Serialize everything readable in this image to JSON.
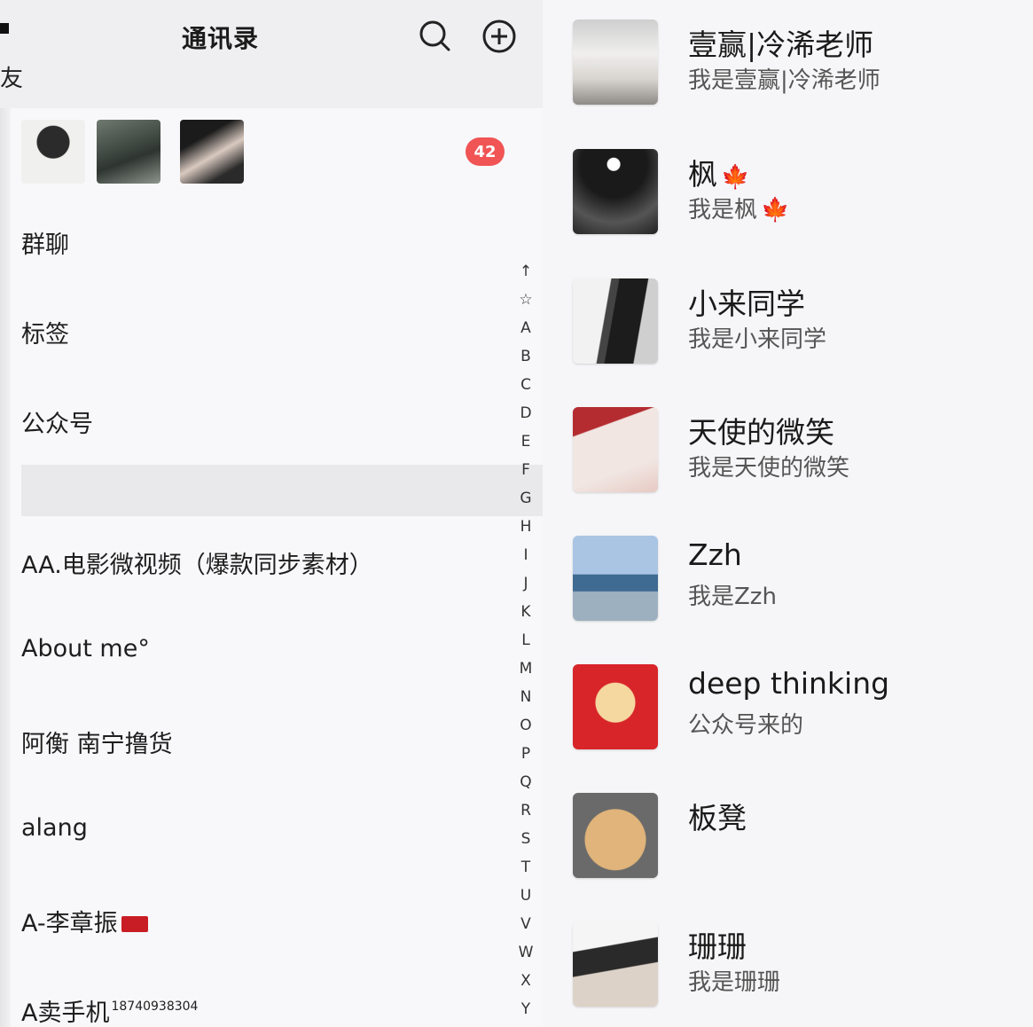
{
  "header": {
    "title": "通讯录"
  },
  "badge_count": "42",
  "menu": {
    "group_chat": "群聊",
    "tags": "标签",
    "official_accounts": "公众号"
  },
  "contacts": [
    {
      "name": "AA.电影微视频（爆款同步素材）"
    },
    {
      "name": "About me°"
    },
    {
      "name": "阿衡 南宁撸货"
    },
    {
      "name": "alang"
    },
    {
      "name": "A-李章振"
    },
    {
      "name": "A卖手机",
      "sup": "18740938304"
    }
  ],
  "alpha_index": [
    "↑",
    "☆",
    "A",
    "B",
    "C",
    "D",
    "E",
    "F",
    "G",
    "H",
    "I",
    "J",
    "K",
    "L",
    "M",
    "N",
    "O",
    "P",
    "Q",
    "R",
    "S",
    "T",
    "U",
    "V",
    "W",
    "X",
    "Y"
  ],
  "right_list": [
    {
      "name": "壹赢|冷浠老师",
      "sub": "我是壹赢|冷浠老师"
    },
    {
      "name": "枫",
      "sub": "我是枫"
    },
    {
      "name": "小来同学",
      "sub": "我是小来同学"
    },
    {
      "name": "天使的微笑",
      "sub": "我是天使的微笑"
    },
    {
      "name": "Zzh",
      "sub": "我是Zzh"
    },
    {
      "name": "deep thinking",
      "sub": "公众号来的"
    },
    {
      "name": "板凳",
      "sub": ""
    },
    {
      "name": "珊珊",
      "sub": "我是珊珊"
    }
  ],
  "edge_glyph": "友",
  "icons": {
    "search": "search-icon",
    "add": "add-circle-icon",
    "leaf": "maple-leaf-icon",
    "flag": "red-flag-icon"
  }
}
